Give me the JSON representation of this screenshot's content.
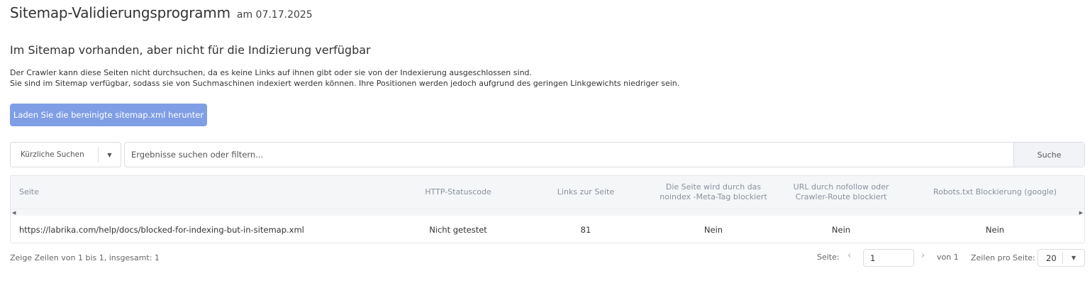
{
  "header": {
    "title": "Sitemap-Validierungsprogramm",
    "date": "am 07.17.2025"
  },
  "section": {
    "title": "Im Sitemap vorhanden, aber nicht für die Indizierung verfügbar",
    "desc_line1": "Der Crawler kann diese Seiten nicht durchsuchen, da es keine Links auf ihnen gibt oder sie von der Indexierung ausgeschlossen sind.",
    "desc_line2": "Sie sind im Sitemap verfügbar, sodass sie von Suchmaschinen indexiert werden können. Ihre Positionen werden jedoch aufgrund des geringen Linkgewichts niedriger sein."
  },
  "download_button": "Laden Sie die bereinigte sitemap.xml herunter",
  "search": {
    "recent_label": "Kürzliche Suchen",
    "placeholder": "Ergebnisse suchen oder filtern...",
    "button": "Suche"
  },
  "table": {
    "headers": {
      "page": "Seite",
      "http": "HTTP-Statuscode",
      "links": "Links zur Seite",
      "noindex": "Die Seite wird durch das noindex -Meta-Tag blockiert",
      "nofollow": "URL durch nofollow oder Crawler-Route blockiert",
      "robots": "Robots.txt Blockierung (google)"
    },
    "rows": [
      {
        "page": "https://labrika.com/help/docs/blocked-for-indexing-but-in-sitemap.xml",
        "http": "Nicht getestet",
        "links": "81",
        "noindex": "Nein",
        "nofollow": "Nein",
        "robots": "Nein"
      }
    ]
  },
  "footer": {
    "info": "Zeige Zeilen von 1 bis 1, insgesamt: 1",
    "page_label": "Seite:",
    "page_value": "1",
    "of_label": "von 1",
    "rows_label": "Zeilen pro Seite:",
    "rows_value": "20"
  },
  "icons": {
    "dropdown": "caret-down-icon",
    "prev": "chevron-left-icon",
    "next": "chevron-right-icon",
    "scroll_left": "arrow-left-icon",
    "scroll_right": "arrow-right-icon"
  },
  "colors": {
    "primary_button": "#7f9ee6",
    "header_bg": "#f4f6f8"
  }
}
